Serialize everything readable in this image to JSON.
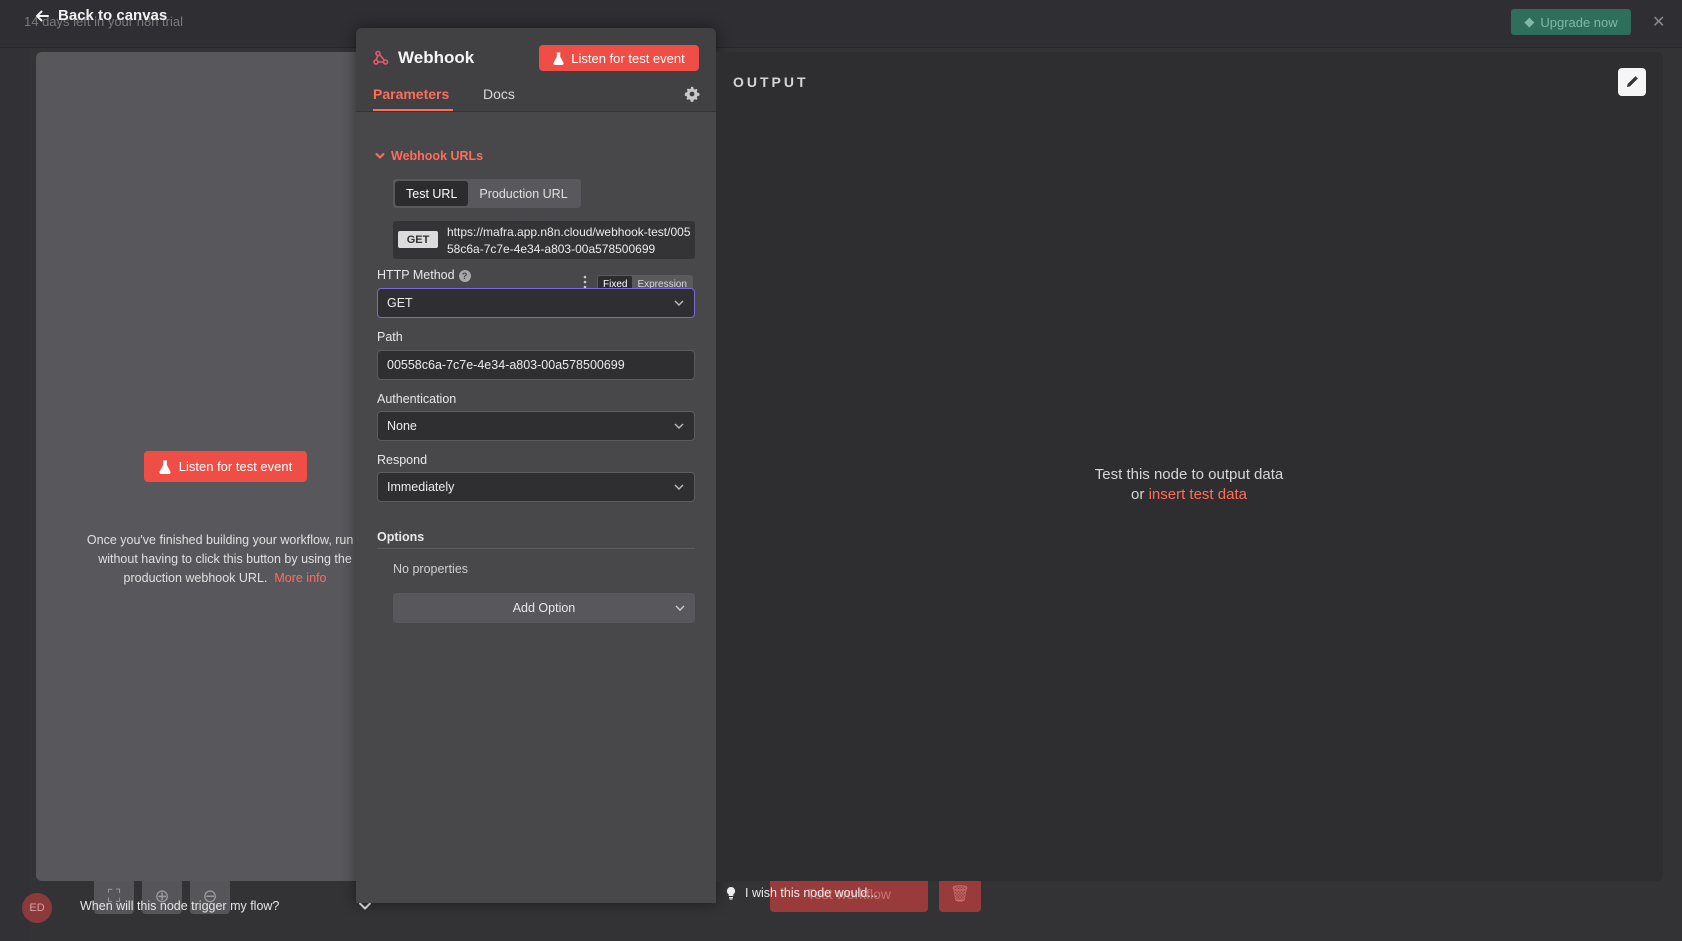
{
  "background": {
    "trial_text": "14 days left in your n8n trial",
    "upgrade_label": "Upgrade now",
    "avatar_initials": "ED",
    "execute_label": "Test workflow"
  },
  "ndv": {
    "back_label": "Back to canvas",
    "input_panel": {
      "listen_label": "Listen for test event",
      "hint_text": "Once you've finished building your workflow, run it without having to click this button by using the production webhook URL.",
      "more_info_label": "More info",
      "trigger_question": "When will this node trigger my flow?"
    },
    "node": {
      "title": "Webhook",
      "listen_label": "Listen for test event",
      "tabs": [
        {
          "label": "Parameters",
          "active": true
        },
        {
          "label": "Docs",
          "active": false
        }
      ],
      "webhook_urls": {
        "section_label": "Webhook URLs",
        "options": [
          "Test URL",
          "Production URL"
        ],
        "selected": "Test URL",
        "method_badge": "GET",
        "url": "https://mafra.app.n8n.cloud/webhook-test/00558c6a-7c7e-4e34-a803-00a578500699"
      },
      "http_method": {
        "label": "HTTP Method",
        "mode_options": [
          "Fixed",
          "Expression"
        ],
        "mode_selected": "Fixed",
        "value": "GET"
      },
      "path": {
        "label": "Path",
        "value": "00558c6a-7c7e-4e34-a803-00a578500699"
      },
      "authentication": {
        "label": "Authentication",
        "value": "None"
      },
      "respond": {
        "label": "Respond",
        "value": "Immediately"
      },
      "options": {
        "label": "Options",
        "empty_text": "No properties",
        "add_label": "Add Option"
      }
    },
    "output_panel": {
      "title": "OUTPUT",
      "empty_line1": "Test this node to output data",
      "empty_or": "or",
      "insert_label": "insert test data"
    },
    "wish_label": "I wish this node would..."
  },
  "colors": {
    "accent": "#ff6d5a",
    "button_red": "#ef4e46",
    "panel_dark": "#2e2e30",
    "panel_mid": "#48484b",
    "panel_left": "#58585c"
  }
}
